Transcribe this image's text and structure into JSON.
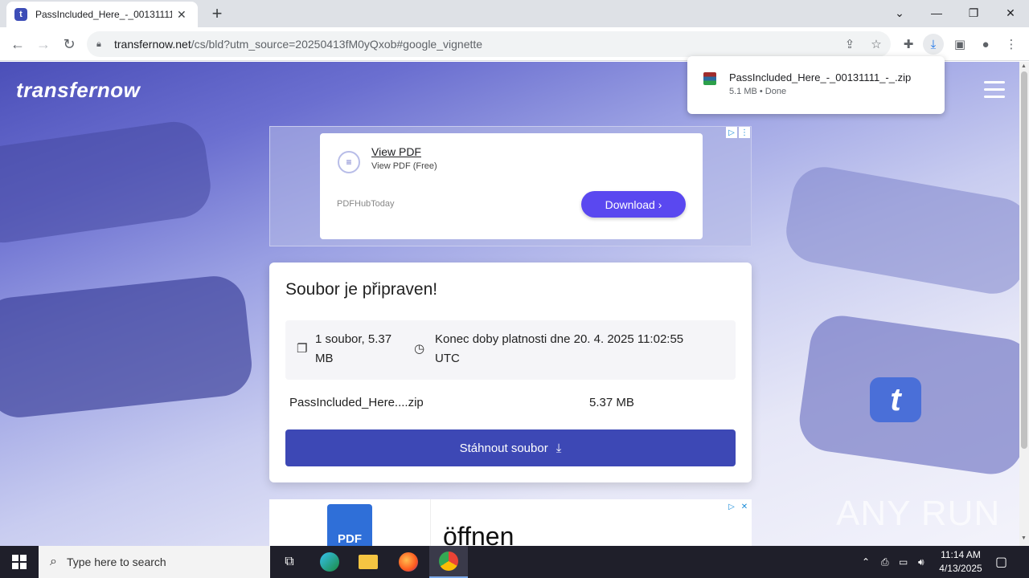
{
  "browser": {
    "tab_title": "PassIncluded_Here_-_00131111_",
    "tab_favicon_letter": "t",
    "url_domain": "transfernow.net",
    "url_path": "/cs/bld?utm_source=20250413fM0yQxob#google_vignette"
  },
  "download_bubble": {
    "filename": "PassIncluded_Here_-_00131111_-_.zip",
    "status": "5.1 MB • Done"
  },
  "site": {
    "logo": "transfernow"
  },
  "ad_top": {
    "title": "View PDF",
    "subtitle": "View PDF (Free)",
    "brand": "PDFHubToday",
    "button": "Download"
  },
  "card": {
    "title": "Soubor je připraven!",
    "files_line1": "1 soubor, 5.37",
    "files_line2": "MB",
    "expiry_line1": "Konec doby platnosti dne 20. 4. 2025 11:02:55",
    "expiry_line2": "UTC",
    "file_name": "PassIncluded_Here....zip",
    "file_size": "5.37 MB",
    "download_button": "Stáhnout soubor"
  },
  "ad_bottom": {
    "icon_label": "PDF",
    "text": "öffnen"
  },
  "watermark": "ANY RUN",
  "taskbar": {
    "search_placeholder": "Type here to search",
    "time": "11:14 AM",
    "date": "4/13/2025"
  }
}
